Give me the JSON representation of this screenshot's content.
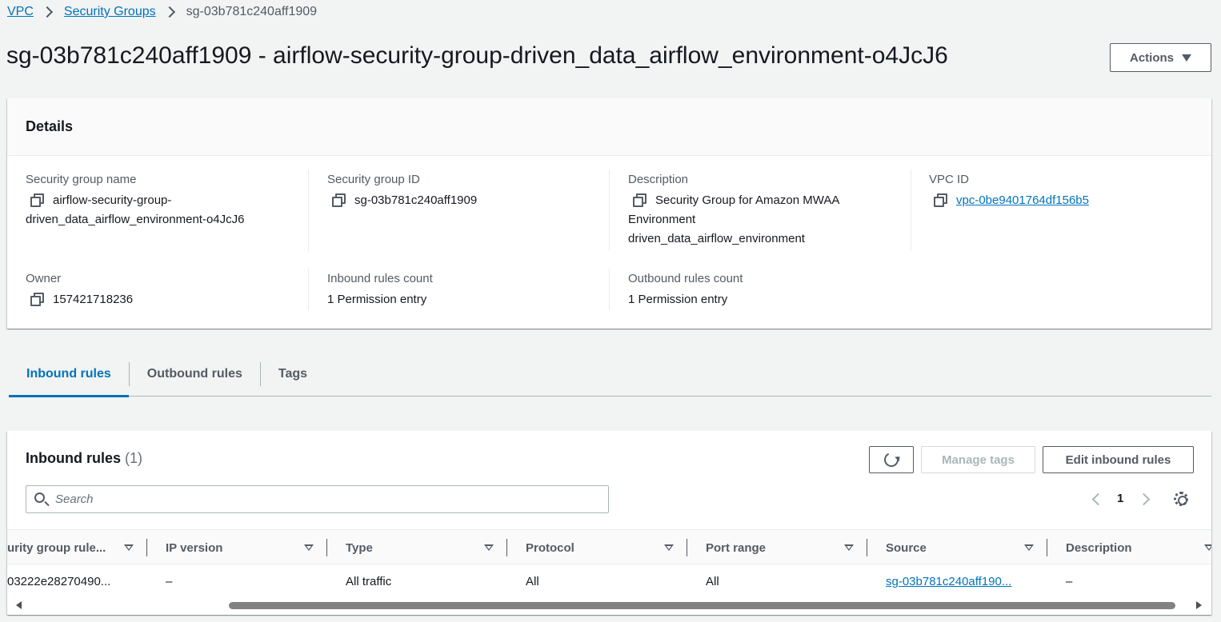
{
  "breadcrumb": {
    "root": "VPC",
    "section": "Security Groups",
    "current": "sg-03b781c240aff1909"
  },
  "header": {
    "title": "sg-03b781c240aff1909 - airflow-security-group-driven_data_airflow_environment-o4JcJ6",
    "actions_label": "Actions"
  },
  "details": {
    "title": "Details",
    "sg_name_label": "Security group name",
    "sg_name_line1": "airflow-security-group-",
    "sg_name_line2": "driven_data_airflow_environment-o4JcJ6",
    "sg_id_label": "Security group ID",
    "sg_id": "sg-03b781c240aff1909",
    "description_label": "Description",
    "description_line1": "Security Group for Amazon MWAA",
    "description_line2": "Environment",
    "description_line3": "driven_data_airflow_environment",
    "vpc_id_label": "VPC ID",
    "vpc_id": "vpc-0be9401764df156b5",
    "owner_label": "Owner",
    "owner": "157421718236",
    "inbound_count_label": "Inbound rules count",
    "inbound_count": "1 Permission entry",
    "outbound_count_label": "Outbound rules count",
    "outbound_count": "1 Permission entry"
  },
  "tabs": [
    "Inbound rules",
    "Outbound rules",
    "Tags"
  ],
  "inbound": {
    "title": "Inbound rules",
    "count": "(1)",
    "manage_tags_label": "Manage tags",
    "edit_label": "Edit inbound rules",
    "search_placeholder": "Search",
    "page": "1",
    "columns": [
      "urity group rule...",
      "IP version",
      "Type",
      "Protocol",
      "Port range",
      "Source",
      "Description"
    ],
    "rows": [
      {
        "rule_id": "03222e28270490...",
        "ip_version": "–",
        "type": "All traffic",
        "protocol": "All",
        "port_range": "All",
        "source": "sg-03b781c240aff190...",
        "description": "–"
      }
    ]
  }
}
